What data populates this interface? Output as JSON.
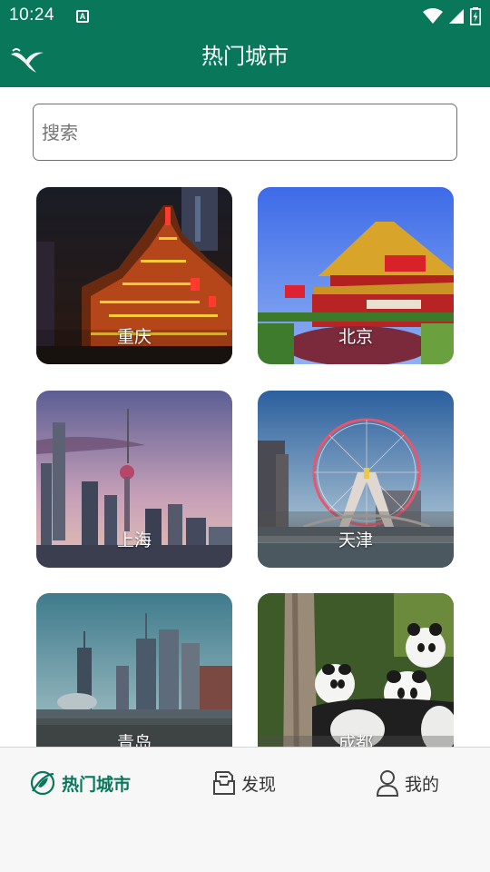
{
  "status_bar": {
    "time": "10:24",
    "notification_letter": "A"
  },
  "app_bar": {
    "title": "热门城市"
  },
  "search": {
    "placeholder": "搜索",
    "value": ""
  },
  "cities": [
    {
      "name": "重庆",
      "photo": "night-riverside-buildings"
    },
    {
      "name": "北京",
      "photo": "tiananmen-gate"
    },
    {
      "name": "上海",
      "photo": "oriental-pearl-skyline"
    },
    {
      "name": "天津",
      "photo": "ferris-wheel-river"
    },
    {
      "name": "青岛",
      "photo": "coastal-skyline"
    },
    {
      "name": "成都",
      "photo": "pandas-tree"
    }
  ],
  "bottom_nav": [
    {
      "label": "热门城市",
      "icon": "planet-leaf-icon",
      "active": true
    },
    {
      "label": "发现",
      "icon": "inbox-icon",
      "active": false
    },
    {
      "label": "我的",
      "icon": "user-icon",
      "active": false
    }
  ],
  "colors": {
    "primary": "#08775a",
    "nav_background": "#f7f7f7"
  }
}
